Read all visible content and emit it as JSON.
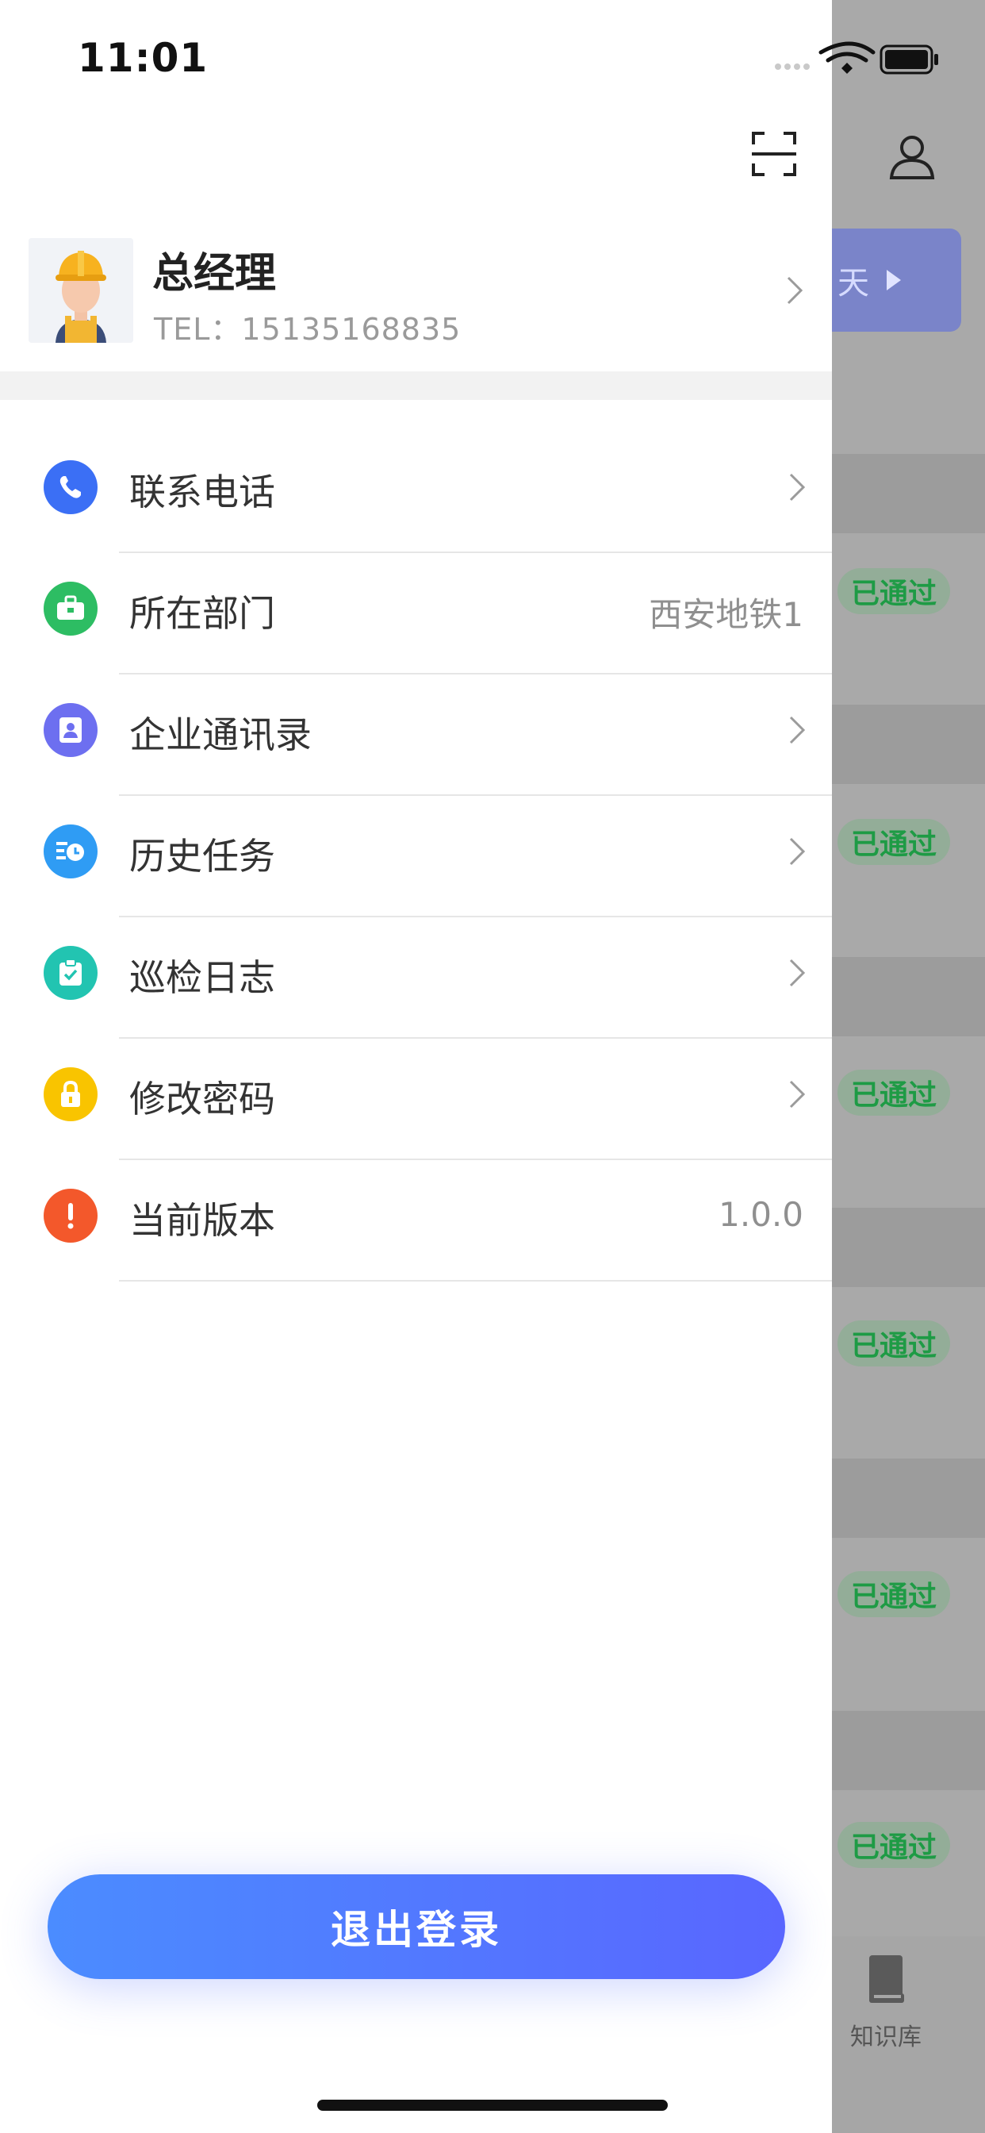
{
  "status_bar": {
    "time": "11:01"
  },
  "profile": {
    "name": "总经理",
    "tel": "TEL：15135168835"
  },
  "menu": {
    "items": [
      {
        "label": "联系电话",
        "value": "",
        "icon": "phone-icon",
        "color": "#3b6ff5"
      },
      {
        "label": "所在部门",
        "value": "西安地铁1",
        "icon": "briefcase-icon",
        "color": "#2dbd63"
      },
      {
        "label": "企业通讯录",
        "value": "",
        "icon": "contacts-icon",
        "color": "#6d6ff0"
      },
      {
        "label": "历史任务",
        "value": "",
        "icon": "history-icon",
        "color": "#2f9cf4"
      },
      {
        "label": "巡检日志",
        "value": "",
        "icon": "clipboard-check-icon",
        "color": "#22c4b1"
      },
      {
        "label": "修改密码",
        "value": "",
        "icon": "lock-icon",
        "color": "#f9c400"
      },
      {
        "label": "当前版本",
        "value": "1.0.0",
        "icon": "exclamation-icon",
        "color": "#f3582b"
      }
    ]
  },
  "logout_label": "退出登录",
  "background": {
    "pill_text": "天",
    "badge_text": "已通过",
    "tab_label": "知识库",
    "badge_color": "#1e9b45"
  }
}
